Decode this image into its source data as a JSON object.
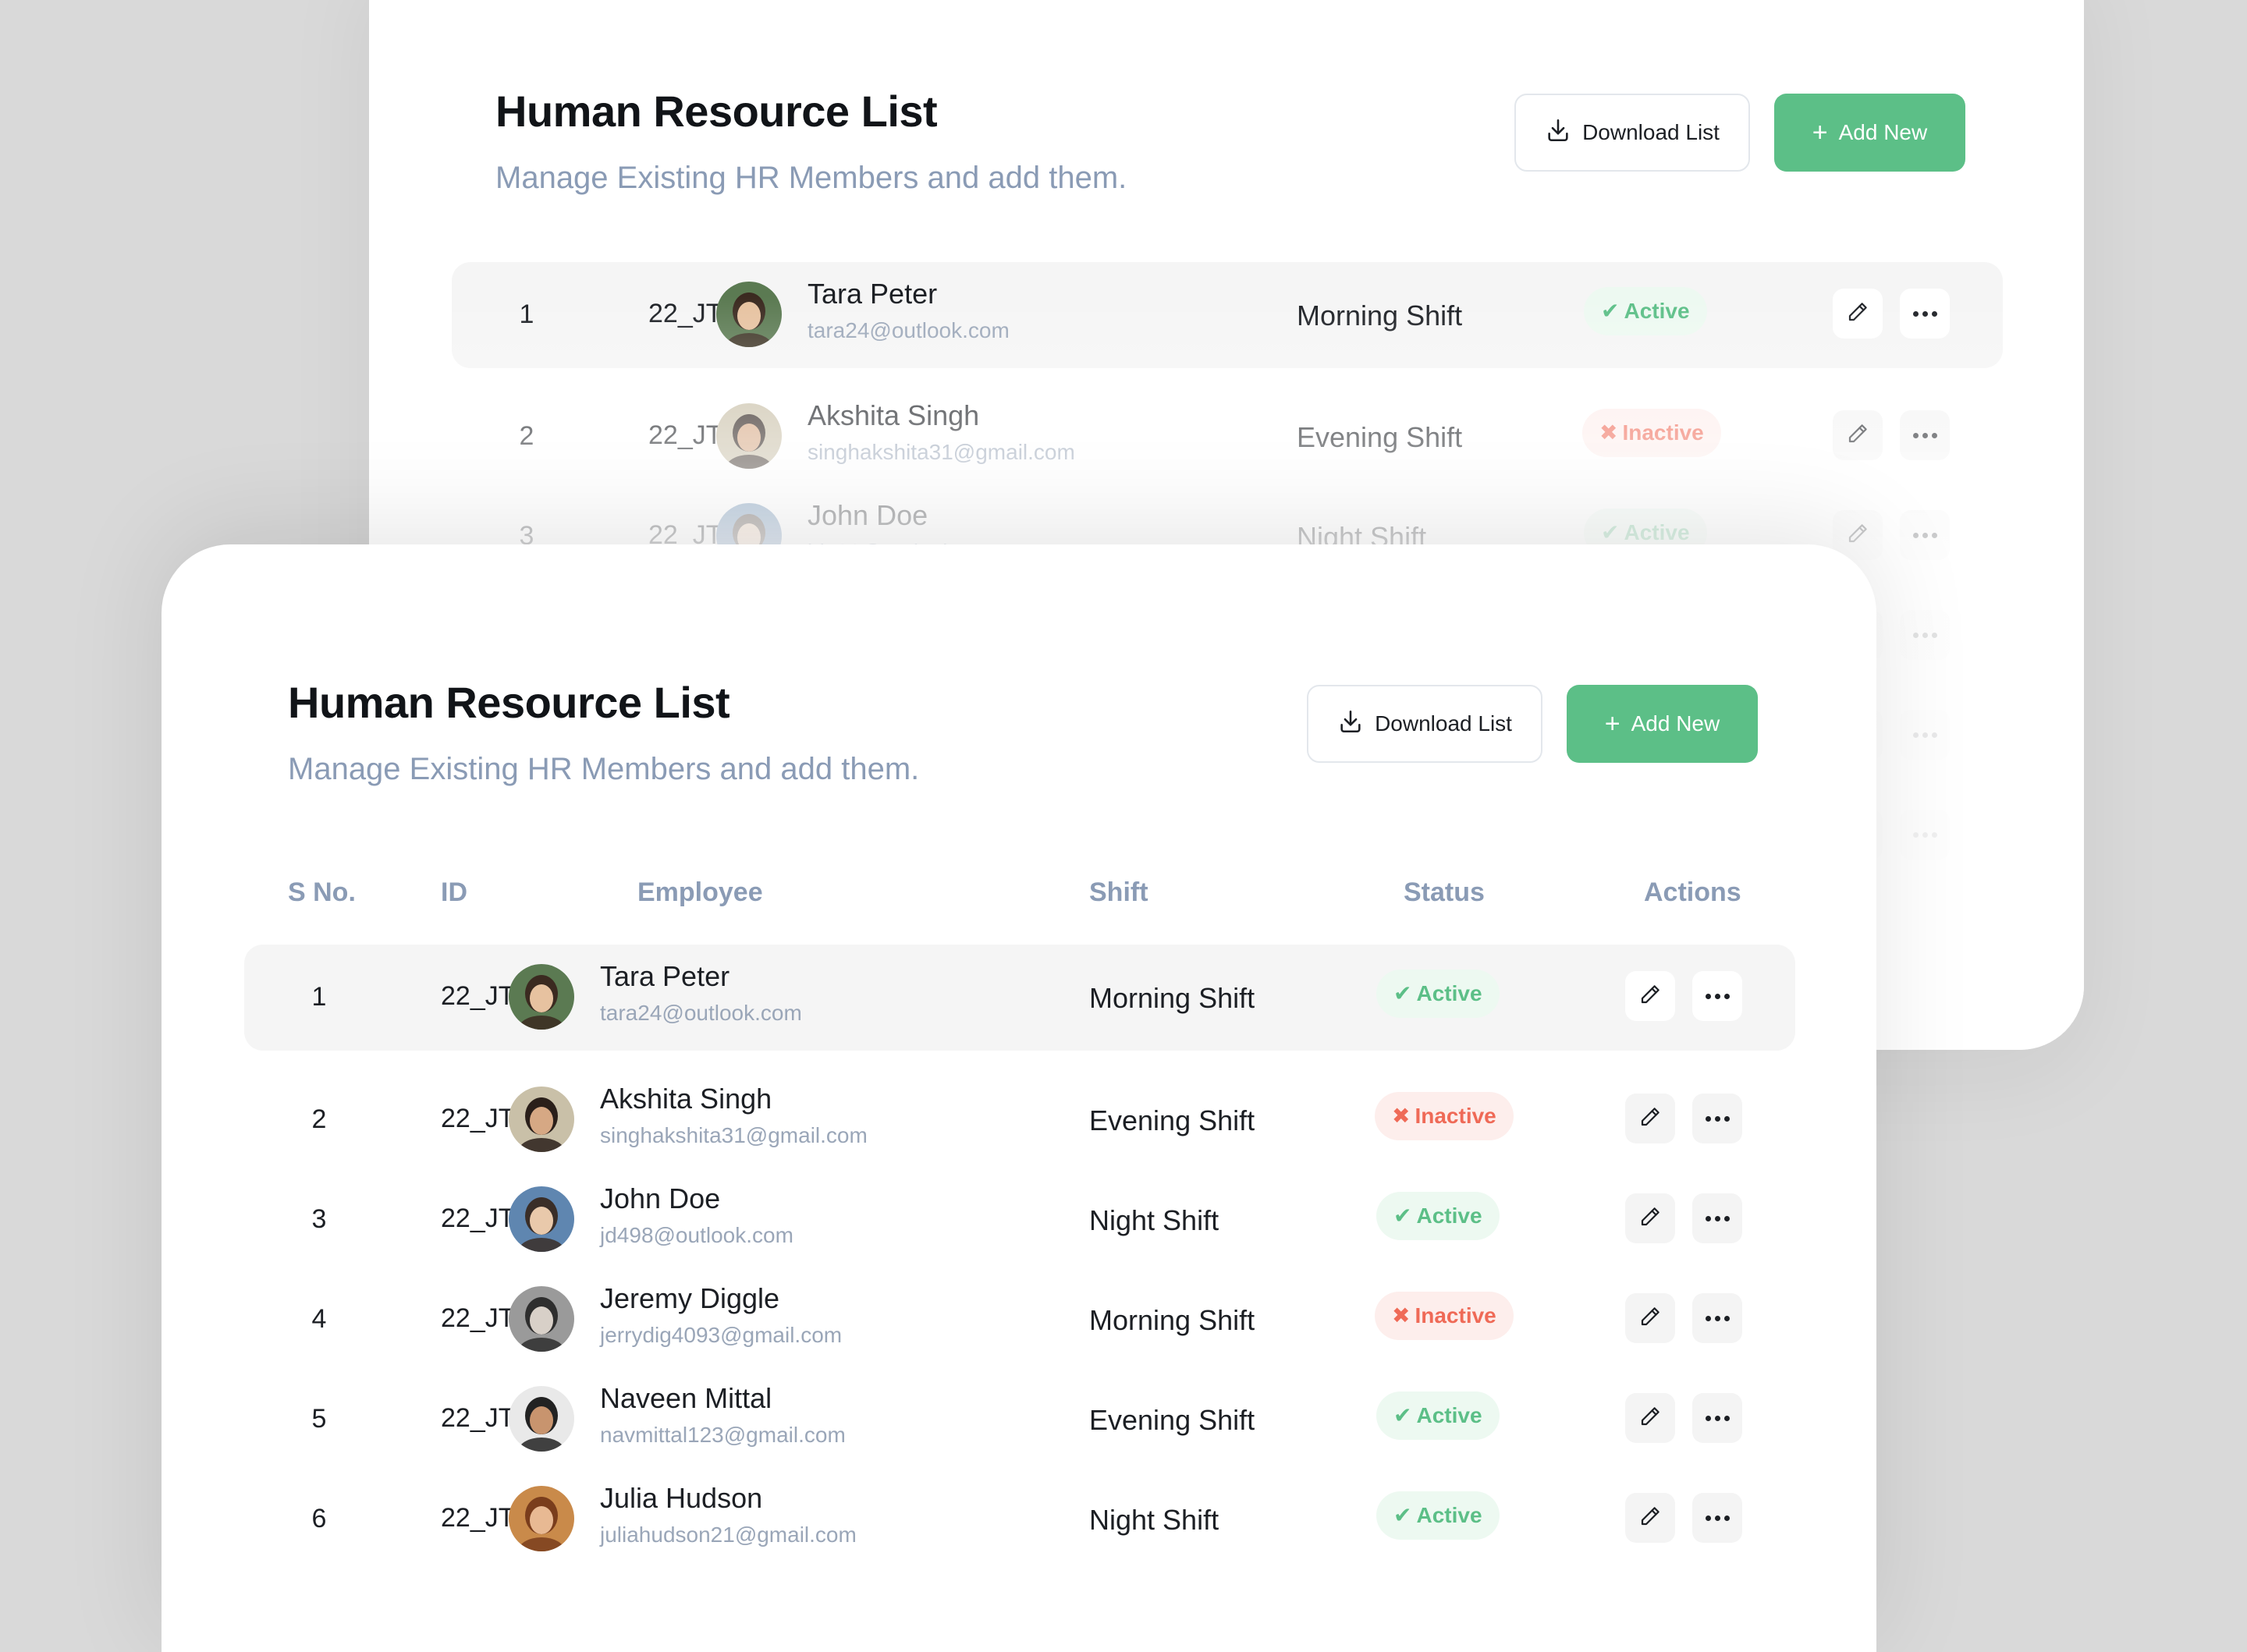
{
  "title": "Human Resource List",
  "subtitle": "Manage Existing HR Members and add them.",
  "buttons": {
    "download": "Download List",
    "add": "Add New",
    "add_icon": "+"
  },
  "columns": {
    "sno": "S No.",
    "id": "ID",
    "employee": "Employee",
    "shift": "Shift",
    "status": "Status",
    "actions": "Actions"
  },
  "status_labels": {
    "active": "Active",
    "inactive": "Inactive"
  },
  "colors": {
    "accent_green": "#5cbf87",
    "inactive_red": "#ef6a57",
    "muted_text": "#8a9bb5"
  },
  "icons": {
    "download": "download-icon",
    "add": "plus-icon",
    "edit": "pencil-icon",
    "more": "more-horizontal-icon",
    "active": "check-icon",
    "inactive": "x-icon"
  },
  "employees": [
    {
      "sno": "1",
      "id": "22_JT22",
      "name": "Tara Peter",
      "email": "tara24@outlook.com",
      "shift": "Morning Shift",
      "status": "Active"
    },
    {
      "sno": "2",
      "id": "22_JT54",
      "name": "Akshita Singh",
      "email": "singhakshita31@gmail.com",
      "shift": "Evening Shift",
      "status": "Inactive"
    },
    {
      "sno": "3",
      "id": "22_JT19",
      "name": "John Doe",
      "email": "jd498@outlook.com",
      "shift": "Night Shift",
      "status": "Active"
    },
    {
      "sno": "4",
      "id": "22_JT23",
      "name": "Jeremy Diggle",
      "email": "jerrydig4093@gmail.com",
      "shift": "Morning Shift",
      "status": "Inactive"
    },
    {
      "sno": "5",
      "id": "22_JT31",
      "name": "Naveen Mittal",
      "email": "navmittal123@gmail.com",
      "shift": "Evening Shift",
      "status": "Active"
    },
    {
      "sno": "6",
      "id": "22_JT37",
      "name": "Julia Hudson",
      "email": "juliahudson21@gmail.com",
      "shift": "Night Shift",
      "status": "Active"
    }
  ]
}
